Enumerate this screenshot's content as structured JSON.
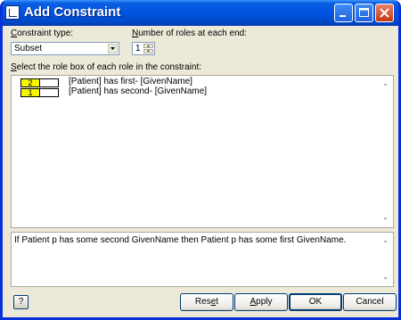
{
  "window": {
    "title": "Add Constraint",
    "colors": {
      "titlebar": "#0054e3",
      "face": "#ece9d8",
      "role_box_highlight": "#f7f700",
      "close_button": "#c4380f"
    }
  },
  "caption_buttons": {
    "minimize_icon": "minimize-icon",
    "maximize_icon": "maximize-icon",
    "close_icon": "close-icon"
  },
  "constraint_type": {
    "label_prefix": "C",
    "label_rest": "onstraint type:",
    "selected_value": "Subset"
  },
  "roles_per_end": {
    "label_prefix": "N",
    "label_rest": "umber of roles at each end:",
    "value": "1"
  },
  "role_select": {
    "label_prefix": "S",
    "label_rest": "elect the role box of each role in the constraint:",
    "rows": [
      {
        "box_number": "2",
        "text": "[Patient] has first- [GivenName]"
      },
      {
        "box_number": "1",
        "text": "[Patient] has second- [GivenName]"
      }
    ]
  },
  "readout": {
    "text": "If Patient p has some second GivenName then Patient p has some first GivenName."
  },
  "buttons": {
    "help": "?",
    "reset_pre": "Res",
    "reset_u": "e",
    "reset_post": "t",
    "apply_u": "A",
    "apply_post": "pply",
    "ok": "OK",
    "cancel": "Cancel"
  }
}
